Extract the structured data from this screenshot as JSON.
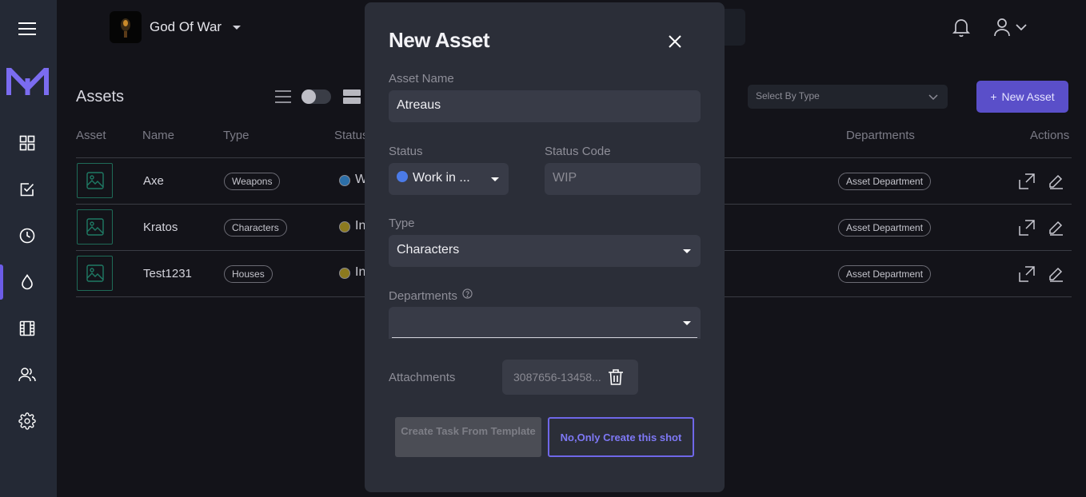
{
  "header": {
    "project_name": "God Of War"
  },
  "assets_page": {
    "title": "Assets",
    "select_type_placeholder": "Select By Type",
    "new_asset_button": "New Asset",
    "columns": {
      "asset": "Asset",
      "name": "Name",
      "type": "Type",
      "status": "Status",
      "departments": "Departments",
      "actions": "Actions"
    },
    "rows": [
      {
        "name": "Axe",
        "type": "Weapons",
        "status_letter": "W",
        "status_color": "#2c6fa8",
        "department": "Asset Department"
      },
      {
        "name": "Kratos",
        "type": "Characters",
        "status_letter": "In",
        "status_color": "#8c7a1f",
        "department": "Asset Department"
      },
      {
        "name": "Test1231",
        "type": "Houses",
        "status_letter": "In",
        "status_color": "#8c7a1f",
        "department": "Asset Department"
      }
    ]
  },
  "modal": {
    "title": "New Asset",
    "asset_name_label": "Asset Name",
    "asset_name_value": "Atreaus",
    "status_label": "Status",
    "status_value": "Work in ...",
    "status_code_label": "Status Code",
    "status_code_value": "WIP",
    "type_label": "Type",
    "type_value": "Characters",
    "departments_label": "Departments",
    "departments_value": "",
    "attachments_label": "Attachments",
    "attachment_file": "3087656-13458...",
    "create_task_button": "Create Task From Template",
    "create_shot_button": "No,Only Create this shot"
  },
  "colors": {
    "accent": "#6f67e8",
    "sidebar_bg": "#242935",
    "modal_bg": "#2b2e38",
    "status_blue": "#4b7be8"
  },
  "icons": {
    "sidebar": [
      "menu-icon",
      "logo-icon",
      "dashboard-icon",
      "tasks-icon",
      "clock-icon",
      "assets-drop-icon",
      "film-icon",
      "users-icon",
      "gear-icon"
    ]
  }
}
